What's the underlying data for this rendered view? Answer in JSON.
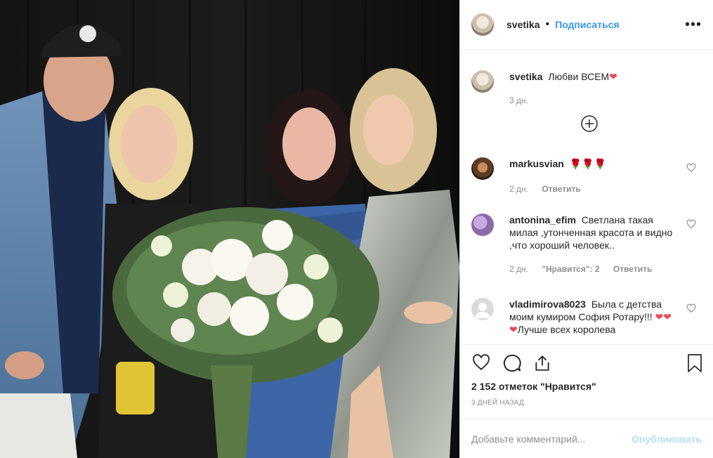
{
  "header": {
    "username": "svetika",
    "separator": "•",
    "follow_label": "Подписаться",
    "more_label": "•••"
  },
  "caption": {
    "username": "svetika",
    "text": "Любви ВСЕМ",
    "heart": "❤",
    "time": "3 дн."
  },
  "comments": [
    {
      "username": "markusvian",
      "text": "🌹🌹🌹",
      "time": "2 дн.",
      "reply": "Ответить"
    },
    {
      "username": "antonina_efim",
      "text": "Светлана такая милая ,утонченная красота и видно ,что хороший человек..",
      "time": "2 дн.",
      "likes": "\"Нравится\": 2",
      "reply": "Ответить"
    },
    {
      "username": "vladimirova8023",
      "text": "Была с детства моим кумиром София Ротару!!!",
      "hearts": "❤❤❤",
      "text2": "Лучше всех королева"
    }
  ],
  "likes_text": "2 152 отметок \"Нравится\"",
  "date_text": "3 ДНЕЙ НАЗАД",
  "comment_placeholder": "Добавьте комментарий...",
  "post_label": "Опубликовать",
  "icons": [
    "heart-icon",
    "comment-icon",
    "share-icon",
    "bookmark-icon",
    "plus-circle-icon",
    "more-icon"
  ]
}
